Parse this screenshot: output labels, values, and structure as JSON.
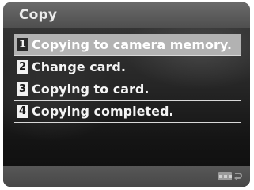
{
  "header": {
    "title": "Copy"
  },
  "menu": {
    "items": [
      {
        "num": "1",
        "label": "Copying to camera memory.",
        "selected": true
      },
      {
        "num": "2",
        "label": "Change card.",
        "selected": false
      },
      {
        "num": "3",
        "label": "Copying to card.",
        "selected": false
      },
      {
        "num": "4",
        "label": "Copying completed.",
        "selected": false
      }
    ]
  },
  "footer": {
    "back_icon": "return-arrow-icon"
  },
  "colors": {
    "header_bg": "#5a5a5a",
    "highlight": "#b2b2b2",
    "text": "#f4f4f4"
  }
}
